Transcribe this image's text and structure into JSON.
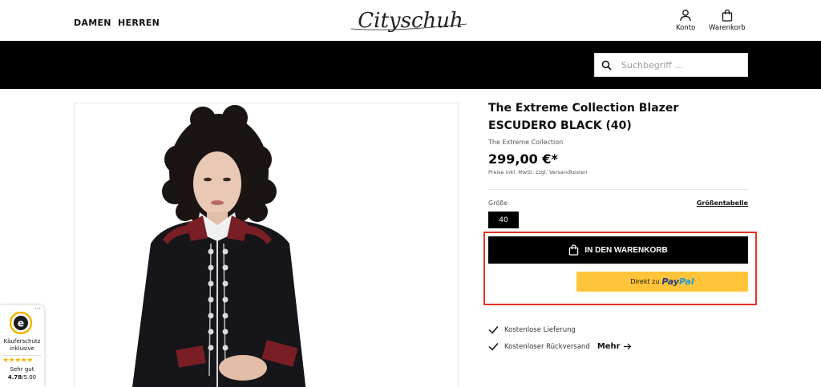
{
  "header": {
    "nav": [
      "DAMEN",
      "HERREN"
    ],
    "logo_text": "Cityschuh",
    "account_label": "Konto",
    "cart_label": "Warenkorb"
  },
  "search": {
    "placeholder": "Suchbegriff ..."
  },
  "product": {
    "title": "The Extreme Collection Blazer ESCUDERO BLACK (40)",
    "manufacturer": "The Extreme Collection",
    "price": "299,00 €*",
    "tax_note": "Preise inkl. MwSt. zzgl. Versandkosten",
    "size_label": "Größe",
    "size_table_link": "Größentabelle",
    "selected_size": "40",
    "add_to_cart_label": "IN DEN WARENKORB",
    "paypal_prefix": "Direkt zu",
    "paypal_brand_pay": "Pay",
    "paypal_brand_pal": "Pal",
    "benefits": [
      "Kostenlose Lieferung",
      "Kostenloser Rückversand"
    ],
    "more_label": "Mehr"
  },
  "trust_badge": {
    "line1": "Käuferschutz",
    "line2": "inklusive",
    "rating_label": "Sehr gut",
    "rating_value": "4.78",
    "rating_max": "/5.00",
    "stars": 5
  },
  "colors": {
    "highlight": "#e53123",
    "paypal_yellow": "#ffc439",
    "paypal_dark": "#253b80",
    "paypal_light": "#179bd7",
    "star": "#f7b500"
  }
}
